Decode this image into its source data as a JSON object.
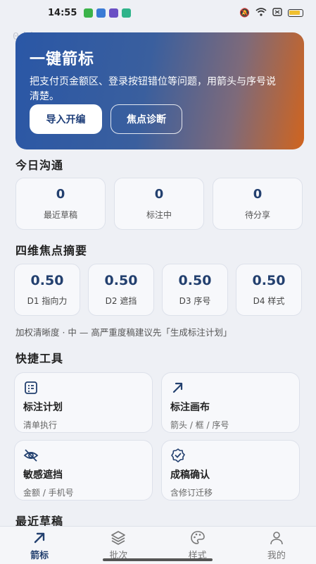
{
  "status": {
    "time": "14:55"
  },
  "watermark": "0ddc39",
  "hero": {
    "title": "一键箭标",
    "desc": "把支付页金额区、登录按钮错位等问题，用箭头与序号说清楚。",
    "btn_import": "导入开编",
    "btn_diagnose": "焦点诊断"
  },
  "today": {
    "title": "今日沟通",
    "stats": [
      {
        "value": "0",
        "label": "最近草稿"
      },
      {
        "value": "0",
        "label": "标注中"
      },
      {
        "value": "0",
        "label": "待分享"
      }
    ]
  },
  "focus": {
    "title": "四维焦点摘要",
    "dims": [
      {
        "value": "0.50",
        "label": "D1 指向力"
      },
      {
        "value": "0.50",
        "label": "D2 遮挡"
      },
      {
        "value": "0.50",
        "label": "D3 序号"
      },
      {
        "value": "0.50",
        "label": "D4 样式"
      }
    ],
    "note": "加权清晰度 · 中 — 高严重度稿建议先「生成标注计划」"
  },
  "tools": {
    "title": "快捷工具",
    "items": [
      {
        "title": "标注计划",
        "sub": "清单执行",
        "icon": "checklist-icon"
      },
      {
        "title": "标注画布",
        "sub": "箭头 / 框 / 序号",
        "icon": "arrow-icon"
      },
      {
        "title": "敏感遮挡",
        "sub": "金额 / 手机号",
        "icon": "eye-off-icon"
      },
      {
        "title": "成稿确认",
        "sub": "含修订迁移",
        "icon": "badge-check-icon"
      }
    ]
  },
  "recent": {
    "title": "最近草稿"
  },
  "tabs": [
    {
      "label": "箭标",
      "icon": "arrow-icon",
      "active": true
    },
    {
      "label": "批次",
      "icon": "layers-icon",
      "active": false
    },
    {
      "label": "样式",
      "icon": "palette-icon",
      "active": false
    },
    {
      "label": "我的",
      "icon": "user-icon",
      "active": false
    }
  ],
  "colors": {
    "accent": "#23406f",
    "hero_start": "#2a57a6",
    "hero_end": "#d0641e"
  }
}
